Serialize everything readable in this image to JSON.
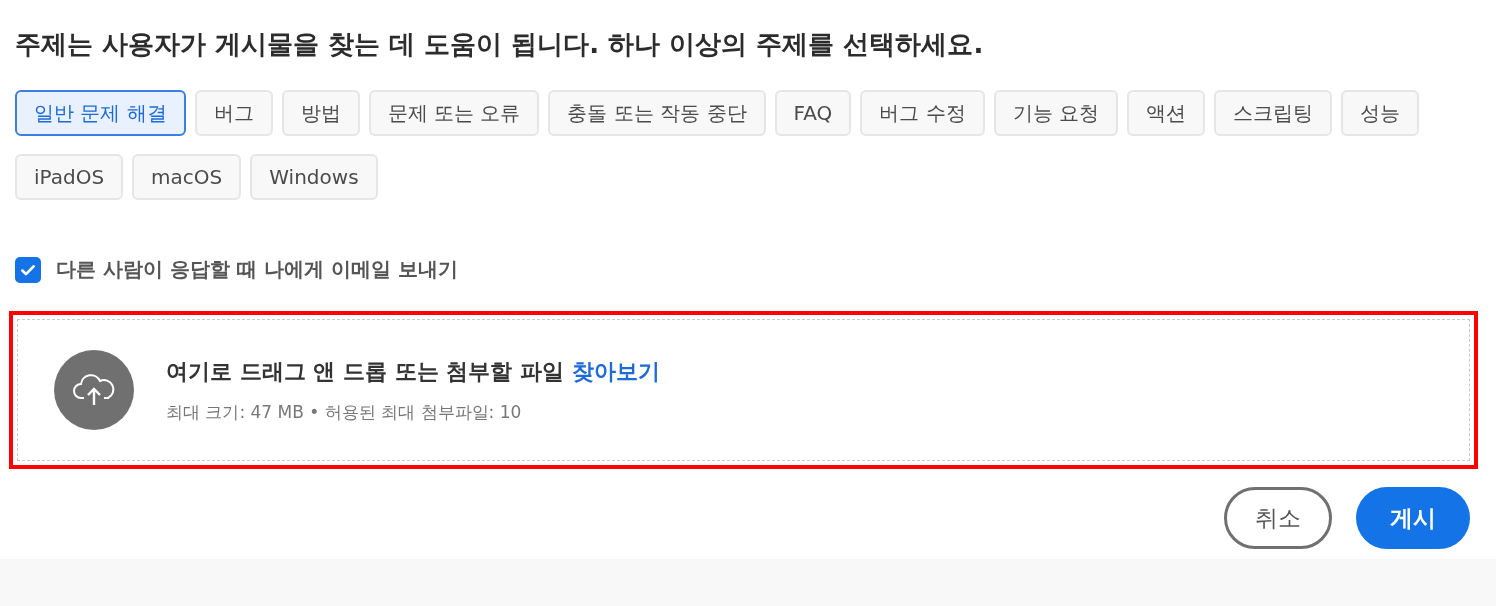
{
  "heading": "주제는 사용자가 게시물을 찾는 데 도움이 됩니다. 하나 이상의 주제를 선택하세요.",
  "topics": [
    {
      "label": "일반 문제 해결",
      "selected": true
    },
    {
      "label": "버그",
      "selected": false
    },
    {
      "label": "방법",
      "selected": false
    },
    {
      "label": "문제 또는 오류",
      "selected": false
    },
    {
      "label": "충돌 또는 작동 중단",
      "selected": false
    },
    {
      "label": "FAQ",
      "selected": false
    },
    {
      "label": "버그 수정",
      "selected": false
    },
    {
      "label": "기능 요청",
      "selected": false
    },
    {
      "label": "액션",
      "selected": false
    },
    {
      "label": "스크립팅",
      "selected": false
    },
    {
      "label": "성능",
      "selected": false
    },
    {
      "label": "iPadOS",
      "selected": false
    },
    {
      "label": "macOS",
      "selected": false
    },
    {
      "label": "Windows",
      "selected": false
    }
  ],
  "email_notify": {
    "label": "다른 사람이 응답할 때 나에게 이메일 보내기",
    "checked": true
  },
  "upload": {
    "highlighted": true,
    "prompt": "여기로 드래그 앤 드롭 또는 첨부할 파일",
    "browse_link": "찾아보기",
    "limits": "최대 크기: 47 MB • 허용된 최대 첨부파일: 10"
  },
  "buttons": {
    "cancel": "취소",
    "post": "게시"
  }
}
